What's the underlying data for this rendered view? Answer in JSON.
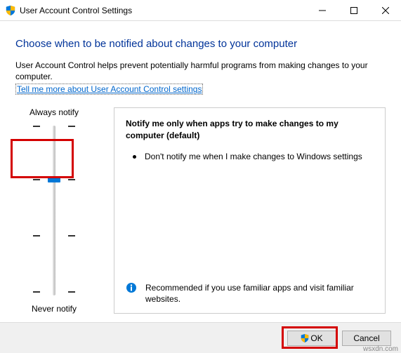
{
  "window": {
    "title": "User Account Control Settings"
  },
  "heading": "Choose when to be notified about changes to your computer",
  "description": "User Account Control helps prevent potentially harmful programs from making changes to your computer.",
  "link": "Tell me more about User Account Control settings",
  "slider": {
    "top_label": "Always notify",
    "bottom_label": "Never notify"
  },
  "panel": {
    "title": "Notify me only when apps try to make changes to my computer (default)",
    "bullet": "Don't notify me when I make changes to Windows settings",
    "recommendation": "Recommended if you use familiar apps and visit familiar websites."
  },
  "buttons": {
    "ok": "OK",
    "cancel": "Cancel"
  },
  "watermark": "wsxdn.com"
}
